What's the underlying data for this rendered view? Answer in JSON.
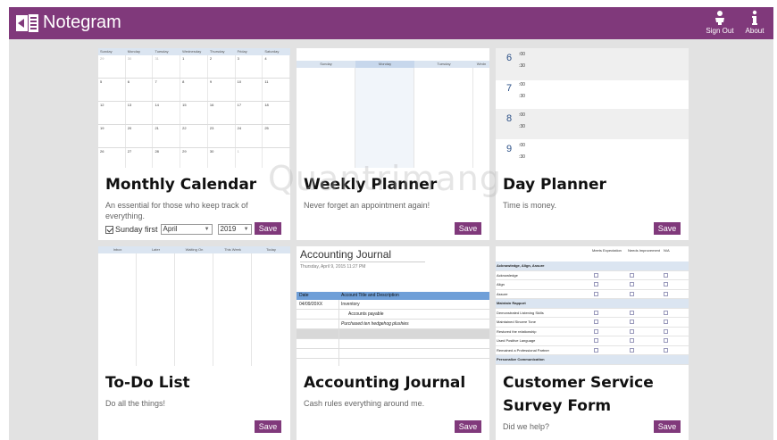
{
  "app": {
    "title": "Notegram",
    "sign_out_label": "Sign Out",
    "about_label": "About",
    "accent_color": "#80397b",
    "background_color": "#e2e2e2"
  },
  "watermark": "Quantrimang",
  "cards": {
    "monthly": {
      "title": "Monthly Calendar",
      "description": "An essential for those who keep track of everything.",
      "sunday_first_label": "Sunday first",
      "sunday_first_checked": true,
      "month_value": "April",
      "year_value": "2019",
      "save_label": "Save",
      "preview": {
        "weekdays": [
          "Sunday",
          "Monday",
          "Tuesday",
          "Wednesday",
          "Thursday",
          "Friday",
          "Saturday"
        ],
        "weeks": [
          [
            "29",
            "30",
            "31",
            "1",
            "2",
            "3",
            "4"
          ],
          [
            "5",
            "6",
            "7",
            "8",
            "9",
            "10",
            "11"
          ],
          [
            "12",
            "13",
            "14",
            "15",
            "16",
            "17",
            "18"
          ],
          [
            "19",
            "20",
            "21",
            "22",
            "23",
            "24",
            "25"
          ],
          [
            "26",
            "27",
            "28",
            "29",
            "30",
            "1",
            ""
          ]
        ]
      }
    },
    "weekly": {
      "title": "Weekly Planner",
      "description": "Never forget an appointment again!",
      "save_label": "Save",
      "preview": {
        "columns": [
          "Sunday",
          "Monday",
          "Tuesday",
          "Wedn"
        ]
      }
    },
    "day": {
      "title": "Day Planner",
      "description": "Time is money.",
      "save_label": "Save",
      "preview": {
        "hours": [
          "6",
          "7",
          "8",
          "9"
        ],
        "minute_top": ":00",
        "minute_half": ":30"
      }
    },
    "todo": {
      "title": "To-Do List",
      "description": "Do all the things!",
      "save_label": "Save",
      "preview": {
        "columns": [
          "Inbox",
          "Later",
          "Waiting On",
          "This Week",
          "Today"
        ]
      }
    },
    "accounting": {
      "title": "Accounting Journal",
      "description": "Cash rules everything around me.",
      "save_label": "Save",
      "preview": {
        "heading": "Accounting Journal",
        "date_line": "Thursday, April 9, 2015      11:27 PM",
        "col_date": "Date",
        "col_account": "Account Title and Description",
        "rows": [
          {
            "date": "04/09/20XX",
            "text": "Inventory"
          },
          {
            "date": "",
            "text": "Accounts payable"
          },
          {
            "date": "",
            "text": "Purchased ten hedgehog plushies"
          }
        ]
      }
    },
    "survey": {
      "title": "Customer Service Survey Form",
      "description": "Did we help?",
      "save_label": "Save",
      "preview": {
        "col1": "Meets Expectation",
        "col2": "Needs Improvement",
        "col3": "N/A",
        "rows": [
          {
            "label": "Acknowledge, Align, Assure",
            "section": true
          },
          {
            "label": "Acknowledge",
            "section": false
          },
          {
            "label": "Align",
            "section": false
          },
          {
            "label": "Assure",
            "section": false
          },
          {
            "label": "Maintain Rapport",
            "section": true
          },
          {
            "label": "Demonstrated Listening Skills",
            "section": false
          },
          {
            "label": "Maintained Sincere Tone",
            "section": false
          },
          {
            "label": "Restored the relationship",
            "section": false
          },
          {
            "label": "Used Positive Language",
            "section": false
          },
          {
            "label": "Remained a Professional Partner",
            "section": false
          },
          {
            "label": "Personalize Communication",
            "section": true
          }
        ]
      }
    }
  }
}
